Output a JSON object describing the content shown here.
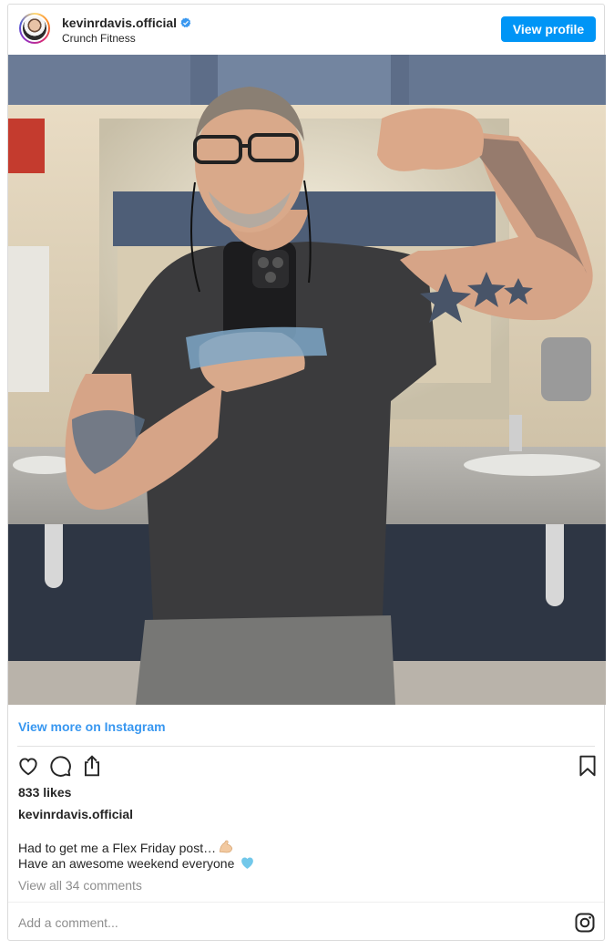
{
  "header": {
    "username": "kevinrdavis.official",
    "location": "Crunch Fitness",
    "view_profile_label": "View profile"
  },
  "photo": {
    "icon": "gym-selfie-photo"
  },
  "links": {
    "view_more": "View more on Instagram"
  },
  "actions": {
    "icons": [
      "heart-icon",
      "comment-icon",
      "share-icon",
      "bookmark-icon"
    ]
  },
  "stats": {
    "likes": "833 likes"
  },
  "caption": {
    "username": "kevinrdavis.official",
    "line1": "Had to get me a Flex Friday post…",
    "line2": "Have an awesome weekend everyone",
    "line1_emoji": "flexed-biceps-emoji",
    "line2_emoji": "light-blue-heart-emoji"
  },
  "comments": {
    "view_all": "View all 34 comments",
    "placeholder": "Add a comment..."
  },
  "colors": {
    "accent": "#0095f6",
    "link": "#3897f0",
    "verified": "#3897f0"
  }
}
